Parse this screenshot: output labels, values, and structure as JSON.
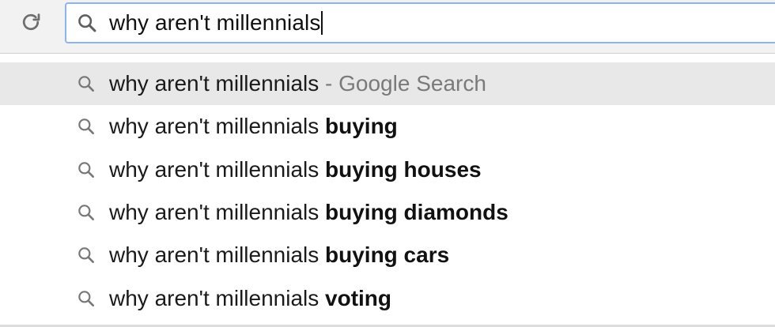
{
  "omnibox": {
    "query": "why aren't millennials",
    "icon": "search-icon"
  },
  "toolbar": {
    "reload_icon": "reload-icon"
  },
  "suggestions": [
    {
      "query": "why aren't millennials",
      "completion": "",
      "separator": " - ",
      "provider": "Google Search"
    },
    {
      "query": "why aren't millennials",
      "completion": "buying"
    },
    {
      "query": "why aren't millennials",
      "completion": "buying houses"
    },
    {
      "query": "why aren't millennials",
      "completion": "buying diamonds"
    },
    {
      "query": "why aren't millennials",
      "completion": "buying cars"
    },
    {
      "query": "why aren't millennials",
      "completion": "voting"
    }
  ],
  "colors": {
    "focus_ring": "#8db4ee",
    "selected_row": "#e8e8e8",
    "toolbar_bg": "#f2f2f2",
    "provider_text": "#7a7a7a"
  }
}
